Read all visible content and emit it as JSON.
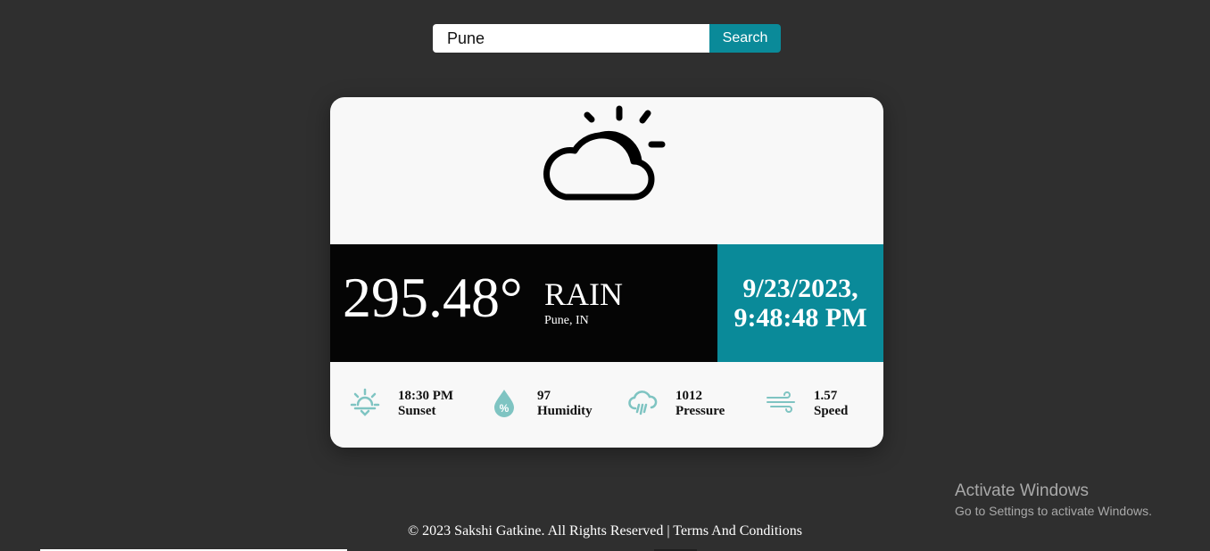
{
  "search": {
    "value": "Pune",
    "button_label": "Search"
  },
  "weather": {
    "icon": "partly-cloudy-icon",
    "temperature": "295.48°",
    "condition": "RAIN",
    "location": "Pune, IN",
    "date": "9/23/2023,",
    "time": "9:48:48 PM"
  },
  "stats": [
    {
      "icon": "sunset-icon",
      "value": "18:30 PM",
      "label": "Sunset"
    },
    {
      "icon": "humidity-icon",
      "value": "97",
      "label": "Humidity"
    },
    {
      "icon": "rain-cloud-icon",
      "value": "1012",
      "label": "Pressure"
    },
    {
      "icon": "wind-icon",
      "value": "1.57",
      "label": "Speed"
    }
  ],
  "footer": {
    "copyright": "© 2023 Sakshi Gatkine. All Rights Reserved |",
    "terms_link": "Terms And Conditions"
  },
  "windows_overlay": {
    "title": "Activate Windows",
    "subtitle": "Go to Settings to activate Windows."
  },
  "colors": {
    "background": "#2f2f2f",
    "accent": "#0a8a99",
    "icon_accent": "#7fc4c2",
    "card": "#f8f8f8"
  }
}
